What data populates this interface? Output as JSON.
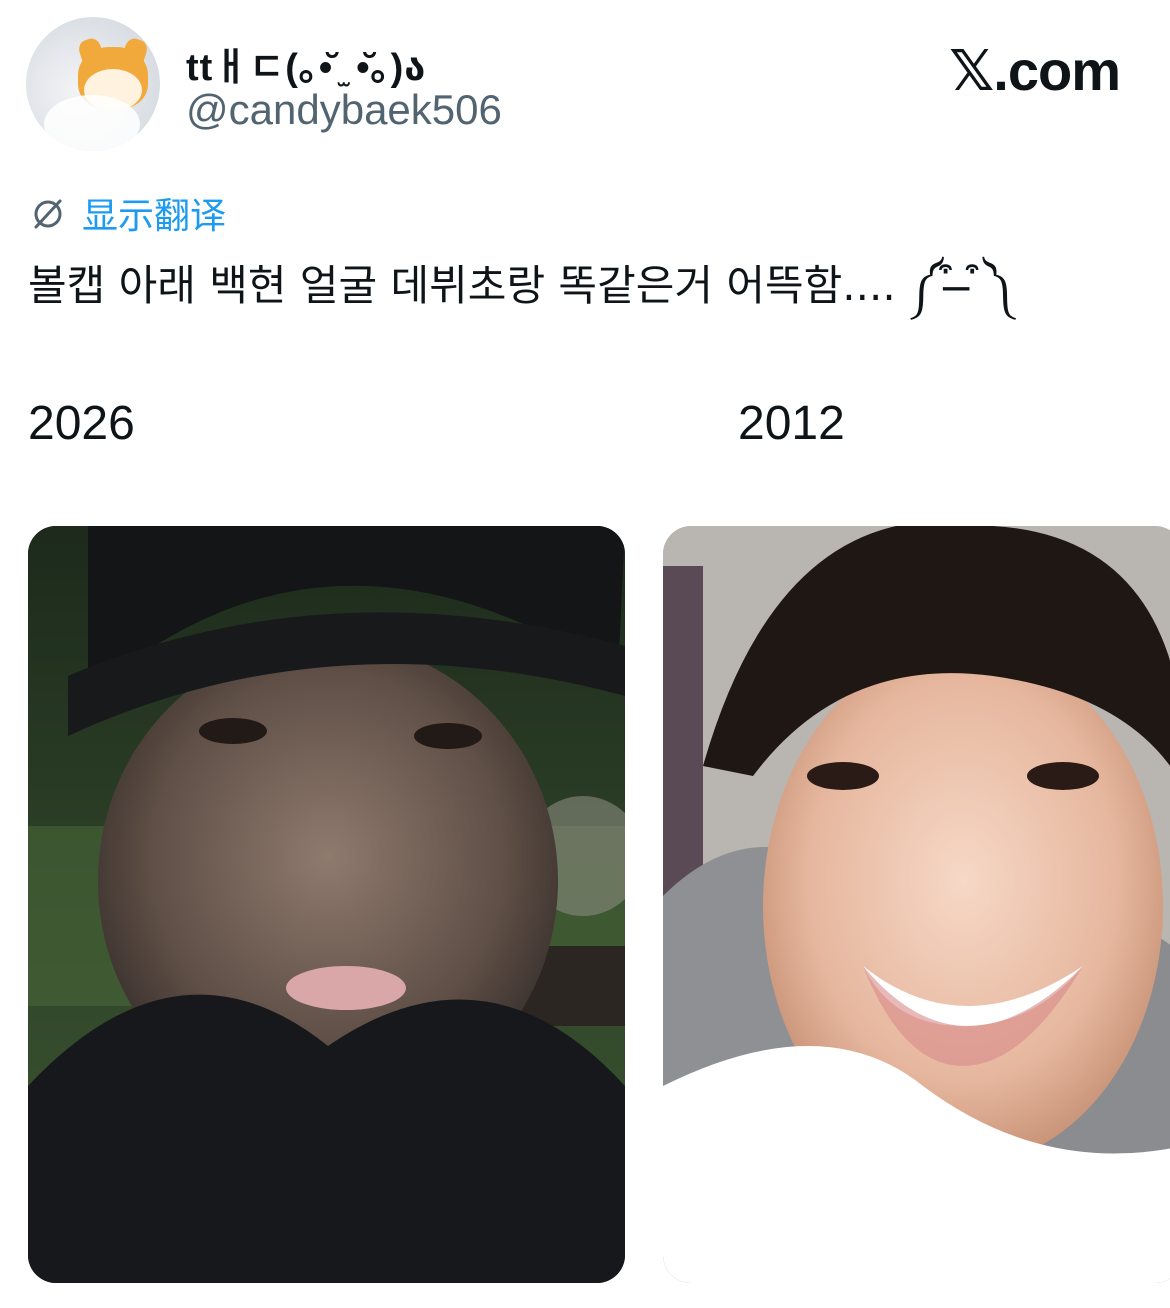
{
  "author": {
    "display_name": "ttㅐㄷ(｡•̆ ̫ •̆｡)ა",
    "handle": "@candybaek506",
    "avatar_icon": "fox-plush-avatar"
  },
  "brand": {
    "label": "𝕏.com"
  },
  "translate": {
    "icon": "no-translate-icon",
    "label": "显示翻译",
    "color": "#1d9bf0"
  },
  "tweet": {
    "text": "볼캡 아래 백현 얼굴 데뷔초랑 똑같은거 어뜩함.... ༼ ͒ ̶ ͒༽"
  },
  "comparison": {
    "left_year": "2026",
    "right_year": "2012"
  }
}
